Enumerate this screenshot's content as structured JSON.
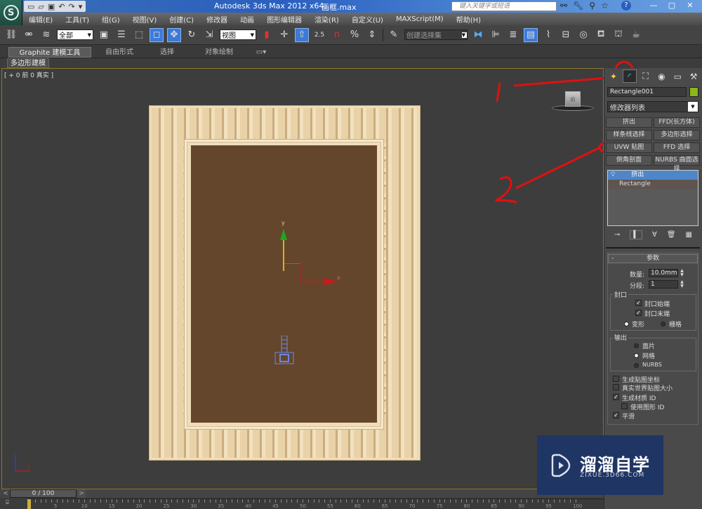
{
  "titlebar": {
    "app_title": "Autodesk 3ds Max  2012 x64",
    "file_title": "画框.max",
    "search_placeholder": "键入关键字或短语",
    "qat_icons": [
      "new-file-icon",
      "open-file-icon",
      "save-icon",
      "undo-icon",
      "redo-icon",
      "customize-icon"
    ],
    "search_tools": [
      "binoculars-icon",
      "wrench-icon",
      "satellite-icon",
      "star-icon",
      "help-icon"
    ],
    "window_controls": [
      "minimize",
      "maximize",
      "close"
    ]
  },
  "menu": [
    "编辑(E)",
    "工具(T)",
    "组(G)",
    "视图(V)",
    "创建(C)",
    "修改器",
    "动画",
    "图形编辑器",
    "渲染(R)",
    "自定义(U)",
    "MAXScript(M)",
    "帮助(H)"
  ],
  "toolbar": {
    "selection_filter": "全部",
    "reference_coord": "视图",
    "named_selection": "创建选择集",
    "snap_angle_label": "2.5"
  },
  "ribbon": {
    "tabs": [
      "Graphite 建模工具",
      "自由形式",
      "选择",
      "对象绘制"
    ],
    "subtab": "多边形建模"
  },
  "viewport": {
    "label": "[ + 0 前 0 真实 ]",
    "gizmo_x": "x",
    "gizmo_y": "y",
    "viewcube_label": "前"
  },
  "annotations": {
    "marker_1": "1",
    "marker_2": "2",
    "color": "#e01010"
  },
  "command_panel": {
    "tabs": [
      "create",
      "modify",
      "hierarchy",
      "motion",
      "display",
      "utilities"
    ],
    "active_tab": "modify",
    "object_name": "Rectangle001",
    "object_color": "#8cb51e",
    "modifier_list": "修改器列表",
    "modifier_buttons": [
      "挤出",
      "FFD(长方体)",
      "样条线选择",
      "多边形选择",
      "UVW 贴图",
      "FFD 选择",
      "倒角剖面",
      "NURBS 曲面选择"
    ],
    "stack": [
      {
        "label": "挤出",
        "selected": true
      },
      {
        "label": "Rectangle",
        "selected": false
      }
    ],
    "params": {
      "title": "参数",
      "amount_label": "数量:",
      "amount_value": "10.0mm",
      "segments_label": "分段:",
      "segments_value": "1",
      "capping_group": "封口",
      "cap_start": {
        "label": "封口始端",
        "checked": true
      },
      "cap_end": {
        "label": "封口末端",
        "checked": true
      },
      "morph": {
        "label": "变形",
        "selected": true
      },
      "grid": {
        "label": "栅格",
        "selected": false
      },
      "output_group": "输出",
      "output_patch": {
        "label": "面片",
        "selected": false
      },
      "output_mesh": {
        "label": "网格",
        "selected": true
      },
      "output_nurbs": {
        "label": "NURBS",
        "selected": false
      },
      "gen_mapping": {
        "label": "生成贴图坐标",
        "checked": false
      },
      "real_world": {
        "label": "真实世界贴图大小",
        "checked": false
      },
      "gen_matid": {
        "label": "生成材质 ID",
        "checked": true
      },
      "use_shape_id": {
        "label": "使用图形 ID",
        "checked": false
      },
      "smooth": {
        "label": "平滑",
        "checked": true
      }
    }
  },
  "timeline": {
    "frame_display": "0 / 100",
    "prev": "<",
    "next": ">",
    "current_frame": 0,
    "total_frames": 100,
    "tick_labels": [
      "5",
      "10",
      "15",
      "20",
      "25",
      "30",
      "35",
      "40",
      "45",
      "50",
      "55",
      "60",
      "65",
      "70",
      "75",
      "80",
      "85",
      "90",
      "95",
      "100"
    ]
  },
  "watermark": {
    "brand": "溜溜自学",
    "url": "ZIXUE.3D66.COM"
  }
}
